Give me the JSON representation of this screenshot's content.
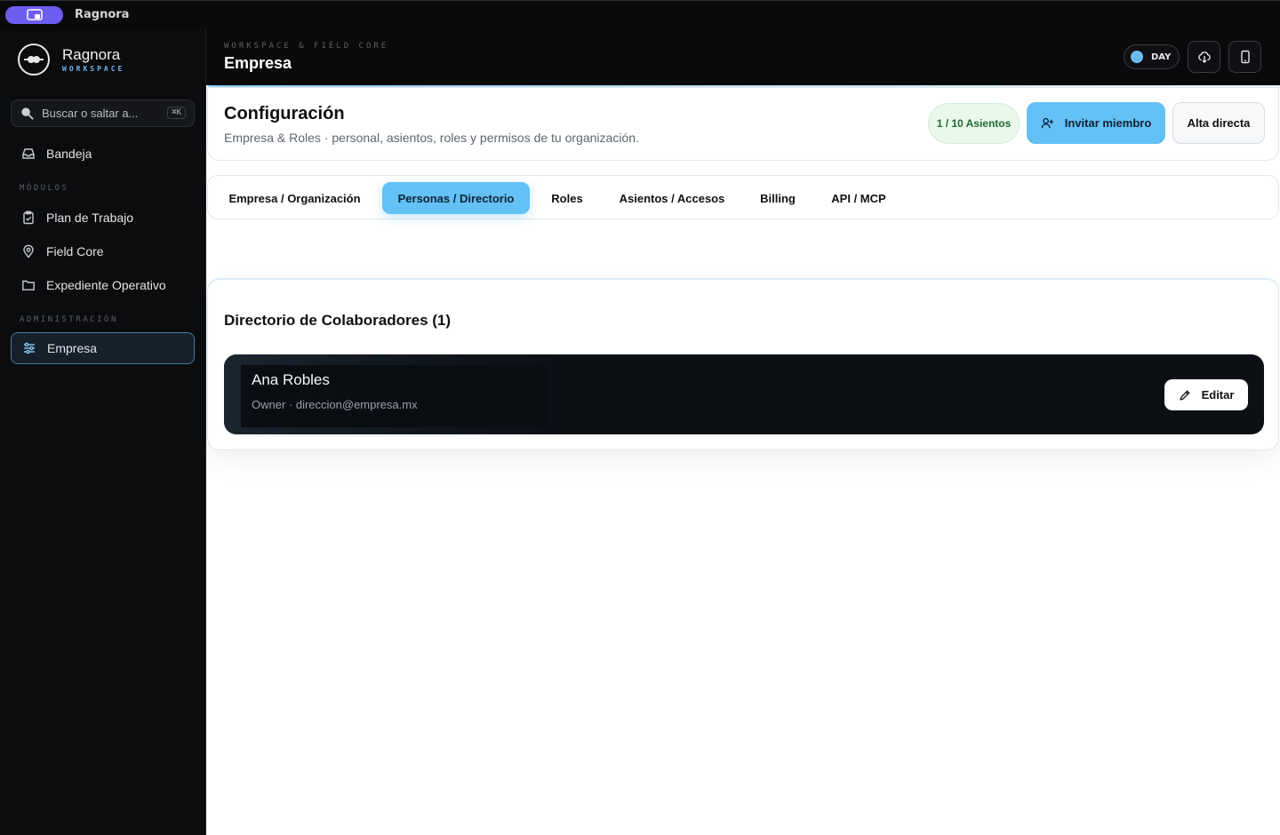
{
  "titlebar": {
    "title": "Ragnora"
  },
  "brand": {
    "name": "Ragnora",
    "sub": "WORKSPACE"
  },
  "search": {
    "placeholder": "Buscar o saltar a...",
    "shortcut": "⌘K"
  },
  "sidebar": {
    "inbox": "Bandeja",
    "section_modules": "MÓDULOS",
    "modules": [
      {
        "label": "Plan de Trabajo",
        "icon": "clipboard-check-icon"
      },
      {
        "label": "Field Core",
        "icon": "map-pin-icon"
      },
      {
        "label": "Expediente Operativo",
        "icon": "folder-icon"
      }
    ],
    "section_admin": "ADMINISTRACIÓN",
    "admin": [
      {
        "label": "Empresa",
        "icon": "sliders-icon",
        "active": true
      }
    ]
  },
  "topbar": {
    "kicker": "WORKSPACE & FIELD CORE",
    "title": "Empresa",
    "day_label": "DAY"
  },
  "header": {
    "title": "Configuración",
    "subtitle": "Empresa & Roles · personal, asientos, roles y permisos de tu organización.",
    "seats_badge": "1 / 10 Asientos",
    "invite_label": "Invitar miembro",
    "direct_label": "Alta directa"
  },
  "tabs": [
    {
      "label": "Empresa / Organización",
      "active": false
    },
    {
      "label": "Personas / Directorio",
      "active": true
    },
    {
      "label": "Roles",
      "active": false
    },
    {
      "label": "Asientos / Accesos",
      "active": false
    },
    {
      "label": "Billing",
      "active": false
    },
    {
      "label": "API / MCP",
      "active": false
    }
  ],
  "directory": {
    "title": "Directorio de Colaboradores (1)",
    "members": [
      {
        "name": "Ana Robles",
        "meta": "Owner · direccion@empresa.mx",
        "edit_label": "Editar"
      }
    ]
  },
  "colors": {
    "accent": "#63c1f5",
    "sidebar_bg": "#0b0c0e",
    "active_border": "#3f7da6",
    "seats_bg": "#eaf8ec"
  }
}
